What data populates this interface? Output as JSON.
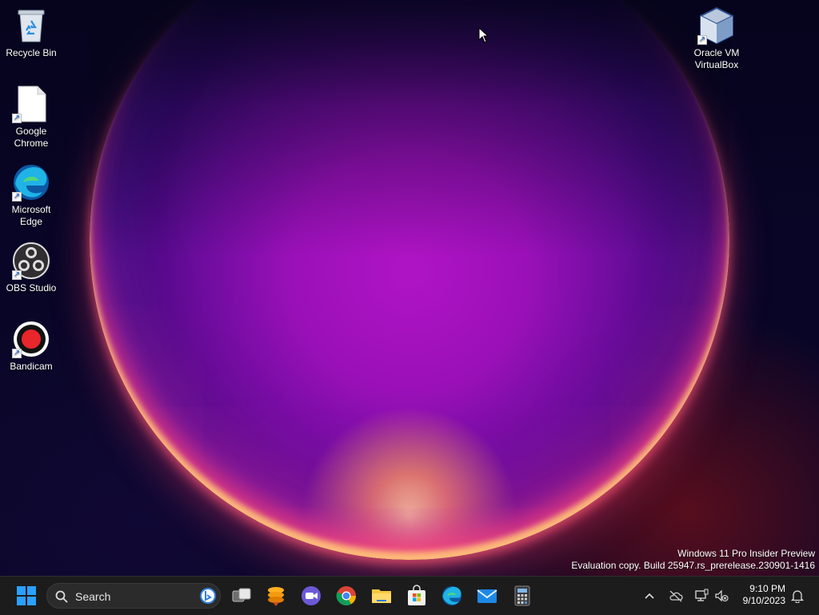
{
  "desktop": {
    "icons": [
      {
        "label_line1": "Recycle Bin",
        "label_line2": "",
        "icon": "recycle-bin-icon"
      },
      {
        "label_line1": "Google",
        "label_line2": "Chrome",
        "icon": "document-icon"
      },
      {
        "label_line1": "Microsoft",
        "label_line2": "Edge",
        "icon": "edge-icon"
      },
      {
        "label_line1": "OBS Studio",
        "label_line2": "",
        "icon": "obs-icon"
      },
      {
        "label_line1": "Bandicam",
        "label_line2": "",
        "icon": "bandicam-icon"
      },
      {
        "label_line1": "Oracle VM",
        "label_line2": "VirtualBox",
        "icon": "virtualbox-icon"
      }
    ],
    "watermark": {
      "line1": "Windows 11 Pro Insider Preview",
      "line2": "Evaluation copy. Build 25947.rs_prerelease.230901-1416"
    }
  },
  "taskbar": {
    "search_placeholder": "Search",
    "apps": [
      "start-icon",
      "task-view-icon",
      "stack-app-icon",
      "teams-meet-icon",
      "chrome-icon",
      "file-explorer-icon",
      "store-icon",
      "edge-icon",
      "mail-icon",
      "calculator-icon"
    ],
    "tray": {
      "time": "9:10 PM",
      "date": "9/10/2023"
    }
  },
  "colors": {
    "taskbar_bg": "#1c1c1c",
    "accent_blue": "#1e90ff"
  }
}
